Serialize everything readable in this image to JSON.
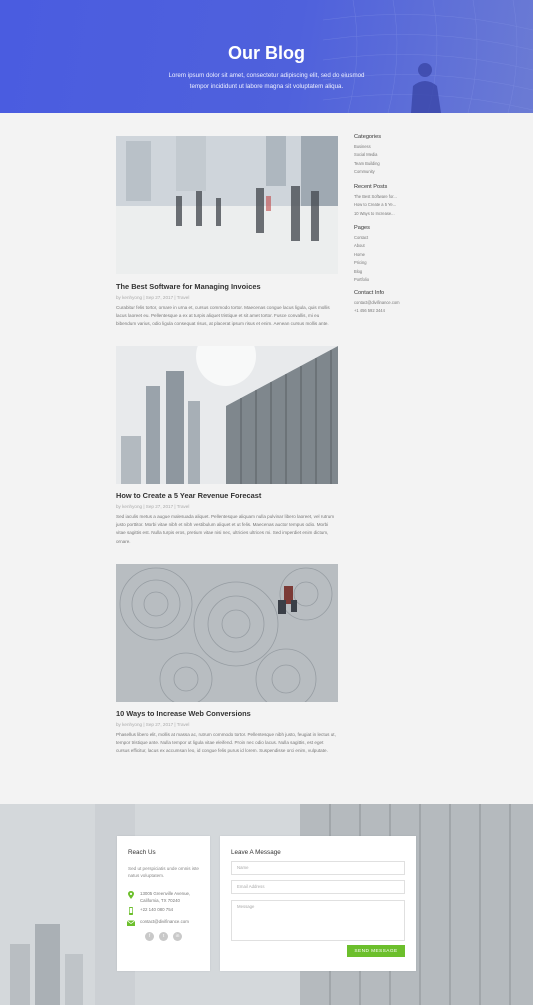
{
  "hero": {
    "title": "Our Blog",
    "subtitle": "Lorem ipsum dolor sit amet, consectetur adipiscing elit, sed do eiusmod tempor incididunt ut labore magna sit voluptatem aliqua."
  },
  "posts": [
    {
      "title": "The Best Software for Managing Invoices",
      "meta": "by kenhyong | Sep 27, 2017 | Travel",
      "excerpt": "Curabitur felis tortor, ornare in urna et, cursus commodo tortor. Maecenas congue lacus ligula, quis mollis lacus laoreet eu. Pellentesque a ex at turpis aliquet tristique et sit amet tortor. Fusce convallis, mi eu bibendum varius, odio ligula consequat risus, at placerat ipsum risus et enim. Aenean cursus mollis ante."
    },
    {
      "title": "How to Create a 5 Year Revenue Forecast",
      "meta": "by kenhyong | Sep 27, 2017 | Travel",
      "excerpt": "Sed iaculis metus a augue malesuada aliquet. Pellentesque aliquam nulla pulvinar libero laoreet, vel rutrum justo porttitor. Morbi vitae nibh et nibh vestibulum aliquet et ut felis. Maecenas auctor tempus odio. Morbi vitae sagittis est. Nulla turpis eros, pretium vitae nisi nec, ultricies ultrices mi. Sed imperdiet enim dictum, ornare."
    },
    {
      "title": "10 Ways to Increase Web Conversions",
      "meta": "by kenhyong | Sep 27, 2017 | Travel",
      "excerpt": "Phasellus libero elit, mollis at massa ac, rutrum commodo tortor. Pellentesque nibh justo, feugiat in lectus ut, tempor tristique ante. Nulla tempor ut ligula vitae eleifend. Proin nec odio lacus. Nulla sagittis, est eget cursus efficitur, lacus ex accumsan leo, id congue felis purus id lorem. Suspendisse orci enim, vulputate."
    }
  ],
  "sidebar": {
    "categories": {
      "title": "Categories",
      "items": [
        "Business",
        "Social Media",
        "Team Building",
        "Community"
      ]
    },
    "recent": {
      "title": "Recent Posts",
      "items": [
        "The Best Software for...",
        "How to Create a 5 Ye...",
        "10 Ways to Increase..."
      ]
    },
    "pages": {
      "title": "Pages",
      "items": [
        "Contact",
        "About",
        "Home",
        "Pricing",
        "Blog",
        "Portfolio"
      ]
    },
    "contact": {
      "title": "Contact Info",
      "items": [
        "contact@divifinance.com",
        "+1 456 592 3444"
      ]
    }
  },
  "footer": {
    "reach": {
      "title": "Reach Us",
      "text": "Sed ut perspiciatis unde omnis iste natus voluptatem.",
      "address": "13005 Greenville Avenue, California, TX 70240",
      "phone": "+22 140 080 754",
      "email": "contact@divifinance.com"
    },
    "message": {
      "title": "Leave A Message",
      "name_placeholder": "Name",
      "email_placeholder": "Email Address",
      "message_placeholder": "Message",
      "send_label": "SEND MESSAGE"
    },
    "socials": [
      "f",
      "t",
      "in"
    ]
  },
  "colors": {
    "hero": "#4a5ce0",
    "accent": "#6cbf2c"
  }
}
